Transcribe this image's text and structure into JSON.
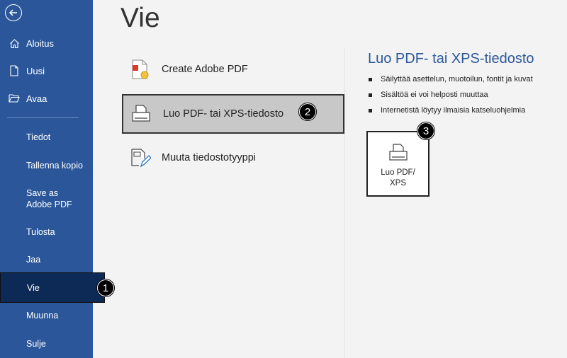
{
  "sidebar": {
    "top_items": [
      {
        "label": "Aloitus",
        "icon": "home-icon"
      },
      {
        "label": "Uusi",
        "icon": "new-document-icon"
      },
      {
        "label": "Avaa",
        "icon": "folder-open-icon"
      }
    ],
    "items": [
      {
        "label": "Tiedot"
      },
      {
        "label": "Tallenna kopio"
      },
      {
        "label": "Save as Adobe PDF"
      },
      {
        "label": "Tulosta"
      },
      {
        "label": "Jaa"
      },
      {
        "label": "Vie"
      },
      {
        "label": "Muunna"
      },
      {
        "label": "Sulje"
      }
    ],
    "selected_item": "Vie",
    "colors": {
      "background": "#2b579a",
      "selected": "#0d2a56"
    }
  },
  "main": {
    "title": "Vie",
    "options": [
      {
        "label": "Create Adobe PDF",
        "icon": "adobe-pdf-icon"
      },
      {
        "label": "Luo PDF- tai XPS-tiedosto",
        "icon": "pdf-xps-icon",
        "active": true
      },
      {
        "label": "Muuta tiedostotyyppi",
        "icon": "change-file-type-icon"
      }
    ]
  },
  "detail": {
    "title": "Luo PDF- tai XPS-tiedosto",
    "bullets": [
      "Säilyttää asettelun, muotoilun, fontit ja kuvat",
      "Sisältöä ei voi helposti muuttaa",
      "Internetistä löytyy ilmaisia katseluohjelmia"
    ],
    "button_label": "Luo PDF/\nXPS",
    "accent_color": "#2b579a"
  },
  "badges": [
    "1",
    "2",
    "3"
  ]
}
